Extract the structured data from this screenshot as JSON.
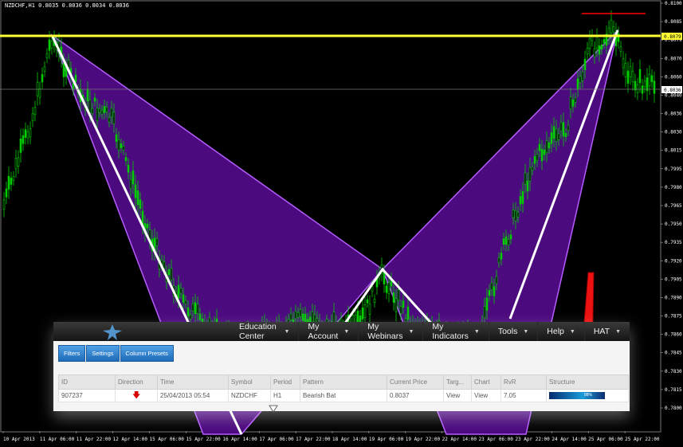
{
  "chart": {
    "title": "NZDCHF,H1 0.8035 0.8036 0.8034 0.8036",
    "price_labels": [
      "0.8100",
      "0.8085",
      "0.8079",
      "0.8070",
      "0.8060",
      "0.8040",
      "0.8036",
      "0.8030",
      "0.8015",
      "0.7995",
      "0.7980",
      "0.7965",
      "0.7950",
      "0.7935",
      "0.7920",
      "0.7905",
      "0.7890",
      "0.7875",
      "0.7860",
      "0.7845",
      "0.7830",
      "0.7815",
      "0.7800"
    ],
    "time_labels": [
      "10 Apr 2013",
      "11 Apr 06:00",
      "11 Apr 22:00",
      "12 Apr 14:00",
      "15 Apr 06:00",
      "15 Apr 22:00",
      "16 Apr 14:00",
      "17 Apr 06:00",
      "17 Apr 22:00",
      "18 Apr 14:00",
      "19 Apr 06:00",
      "19 Apr 22:00",
      "22 Apr 14:00",
      "23 Apr 06:00",
      "23 Apr 22:00",
      "24 Apr 14:00",
      "25 Apr 06:00",
      "25 Apr 22:00"
    ],
    "highlight_price": "0.8079",
    "current_price": "0.8036",
    "colors": {
      "candle": "#00cc00",
      "pattern_fill": "#4b0a7d",
      "pattern_edge": "#b65cff",
      "leg": "#ffffff",
      "level": "#ffff33",
      "level_red": "#ff0000",
      "grid": "#404040"
    }
  },
  "nav": {
    "items": [
      {
        "label": "Education Center"
      },
      {
        "label": "My Account"
      },
      {
        "label": "My Webinars"
      },
      {
        "label": "My Indicators"
      },
      {
        "label": "Tools"
      },
      {
        "label": "Help"
      },
      {
        "label": "HAT"
      }
    ]
  },
  "toolbar": {
    "filters": "Filters",
    "settings": "Settings",
    "column_presets": "Column Presets"
  },
  "table": {
    "headers": [
      "ID",
      "Direction",
      "Time",
      "Symbol",
      "Period",
      "Pattern",
      "Current Price",
      "Targ...",
      "Chart",
      "RvR",
      "Structure"
    ],
    "row": {
      "id": "907237",
      "time": "25/04/2013 05:54",
      "symbol": "NZDCHF",
      "period": "H1",
      "pattern": "Bearish Bat",
      "current_price": "0.8037",
      "target": "View",
      "chart": "View",
      "rvr": "7.05",
      "structure": "88%"
    }
  },
  "annotation": {
    "arrow_color": "#ee1111"
  }
}
